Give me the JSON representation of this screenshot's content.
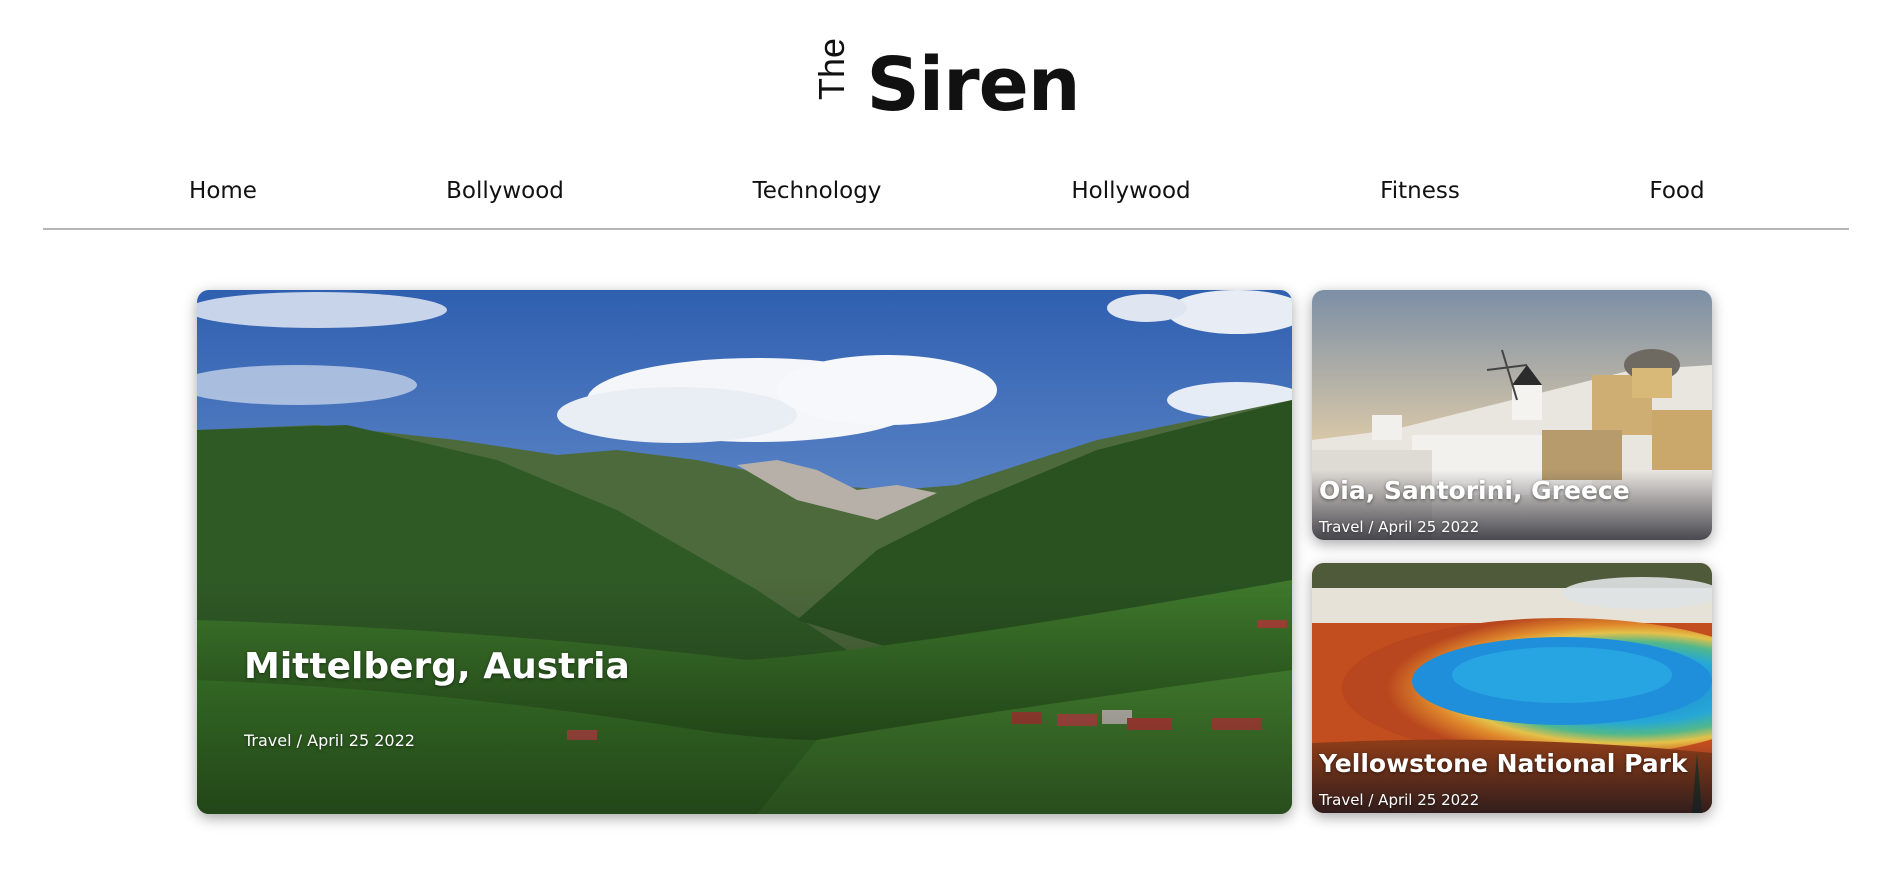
{
  "header": {
    "logo_small": "The",
    "logo_main": "Siren"
  },
  "nav": {
    "items": [
      {
        "label": "Home"
      },
      {
        "label": "Bollywood"
      },
      {
        "label": "Technology"
      },
      {
        "label": "Hollywood"
      },
      {
        "label": "Fitness"
      },
      {
        "label": "Food"
      }
    ]
  },
  "featured": {
    "main": {
      "title": "Mittelberg, Austria",
      "meta": "Travel / April 25 2022"
    },
    "side": [
      {
        "title": "Oia, Santorini, Greece",
        "meta": "Travel / April 25 2022"
      },
      {
        "title": "Yellowstone National Park",
        "meta": "Travel / April 25 2022"
      }
    ]
  }
}
